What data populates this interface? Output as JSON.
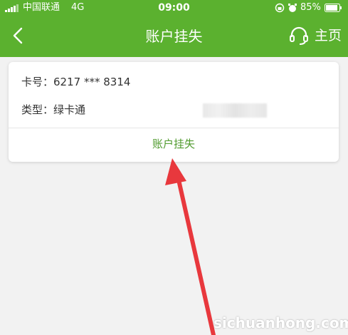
{
  "status_bar": {
    "carrier": "中国联通",
    "network": "4G",
    "time": "09:00",
    "battery": "85%"
  },
  "header": {
    "back_icon": "chevron-left-icon",
    "title": "账户挂失",
    "home_icon": "headset-icon",
    "home_label": "主页"
  },
  "card": {
    "card_number_label": "卡号：",
    "card_number": "6217 *** 8314",
    "type_label": "类型：",
    "type_value": "绿卡通",
    "action_label": "账户挂失"
  },
  "watermark": "sichuanhong.com",
  "colors": {
    "brand_green": "#5bb12f",
    "action_green": "#4f9a2d",
    "arrow_red": "#e8383d"
  }
}
